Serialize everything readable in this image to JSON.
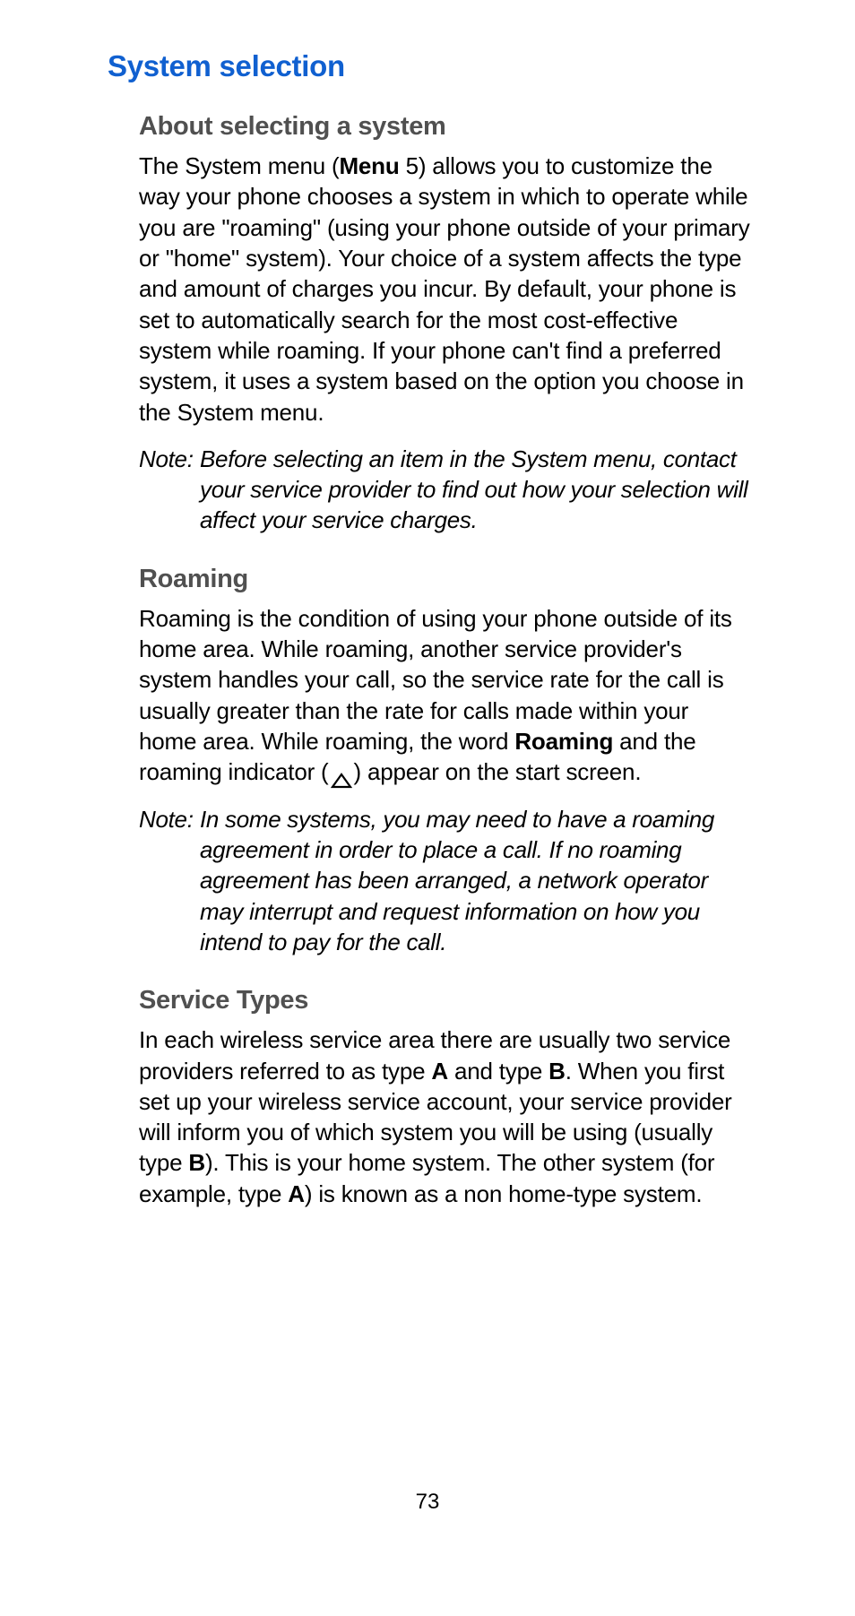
{
  "heading": "System selection",
  "sections": {
    "about": {
      "title": "About selecting a system",
      "para_pre": "The System menu (",
      "para_bold1": "Menu",
      "para_mid": " 5) allows you to customize the way your phone chooses a system in which to operate while you are \"roaming\" (using your phone outside of your primary or \"home\" system). Your choice of a system affects the type and amount of charges you incur. By default, your phone is set to automatically search for the most cost-effective system while roaming. If your phone can't find a preferred system, it uses a system based on the option you choose in the System menu.",
      "note_label": "Note:",
      "note_text": "Before selecting an item in the System menu, contact your service provider to find out how your selection will affect your service charges."
    },
    "roaming": {
      "title": "Roaming",
      "para_pre": "Roaming is the condition of using your phone outside of its home area. While roaming, another service provider's system handles your call, so the service rate for the call is usually greater than the rate for calls made within your home area. While roaming, the word ",
      "para_bold1": "Roaming",
      "para_mid": " and the roaming indicator (",
      "para_end": ") appear on the start screen.",
      "note_label": "Note:",
      "note_text": "In some systems, you may need to have a roaming agreement in order to place a call. If no roaming agreement has been arranged, a network operator may interrupt and request information on how you intend to pay for the call."
    },
    "service": {
      "title": "Service Types",
      "para_pre": "In each wireless service area there are usually two service providers referred to as type ",
      "para_bold1": "A",
      "para_mid1": " and type ",
      "para_bold2": "B",
      "para_mid2": ". When you first set up your wireless service account, your service provider will inform you of which system you will be using (usually type ",
      "para_bold3": "B",
      "para_mid3": "). This is your home system. The other system (for example, type ",
      "para_bold4": "A",
      "para_end": ") is known as a non home-type system."
    }
  },
  "page_number": "73"
}
